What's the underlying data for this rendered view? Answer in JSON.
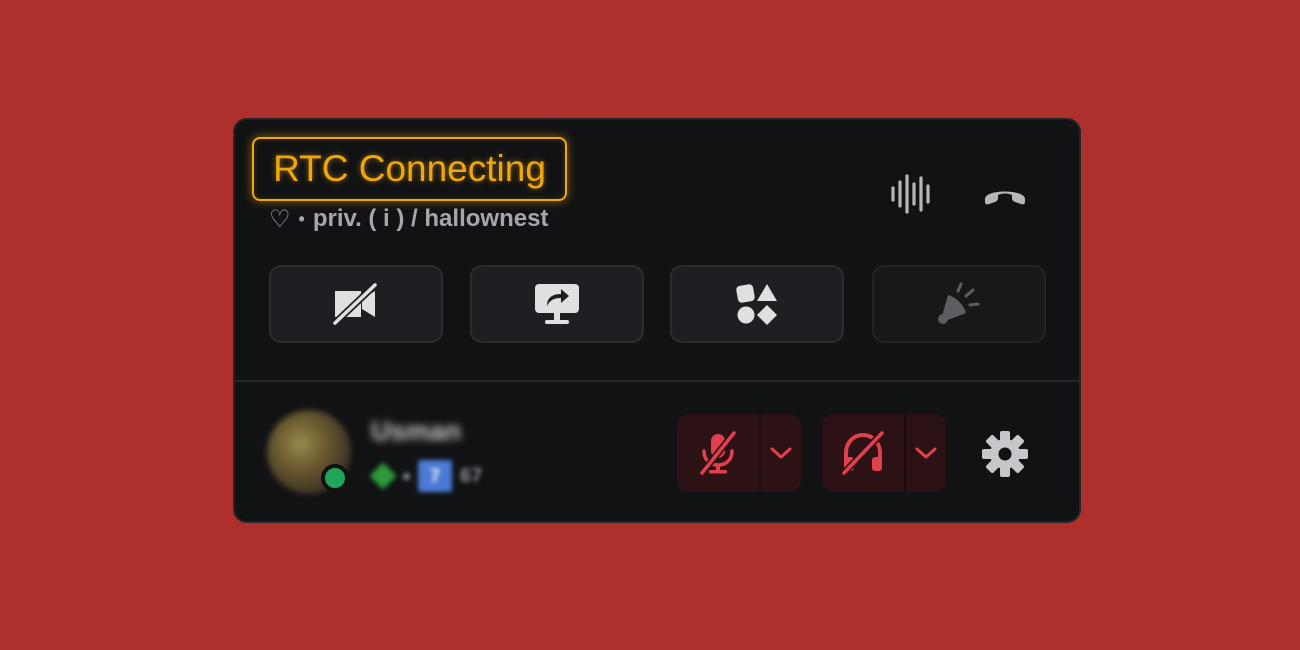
{
  "status": {
    "label": "RTC Connecting",
    "color": "#f0a70f"
  },
  "channel": {
    "heart_glyph": "♡",
    "separator": "•",
    "path": "priv. ( i ) / hallownest"
  },
  "top_icons": [
    "noise-suppression-icon",
    "disconnect-icon"
  ],
  "actions": [
    {
      "name": "camera-off-icon",
      "enabled": true
    },
    {
      "name": "share-screen-icon",
      "enabled": true
    },
    {
      "name": "activities-icon",
      "enabled": true
    },
    {
      "name": "soundboard-icon",
      "enabled": false
    }
  ],
  "user": {
    "name": "Usman",
    "tag": "7",
    "tag_suffix": "67",
    "presence_color": "#23a559"
  },
  "controls": {
    "mute_icon": "microphone-muted-icon",
    "deafen_icon": "headphones-deafened-icon",
    "settings_icon": "gear-icon",
    "muted_color": "#e2404c"
  }
}
